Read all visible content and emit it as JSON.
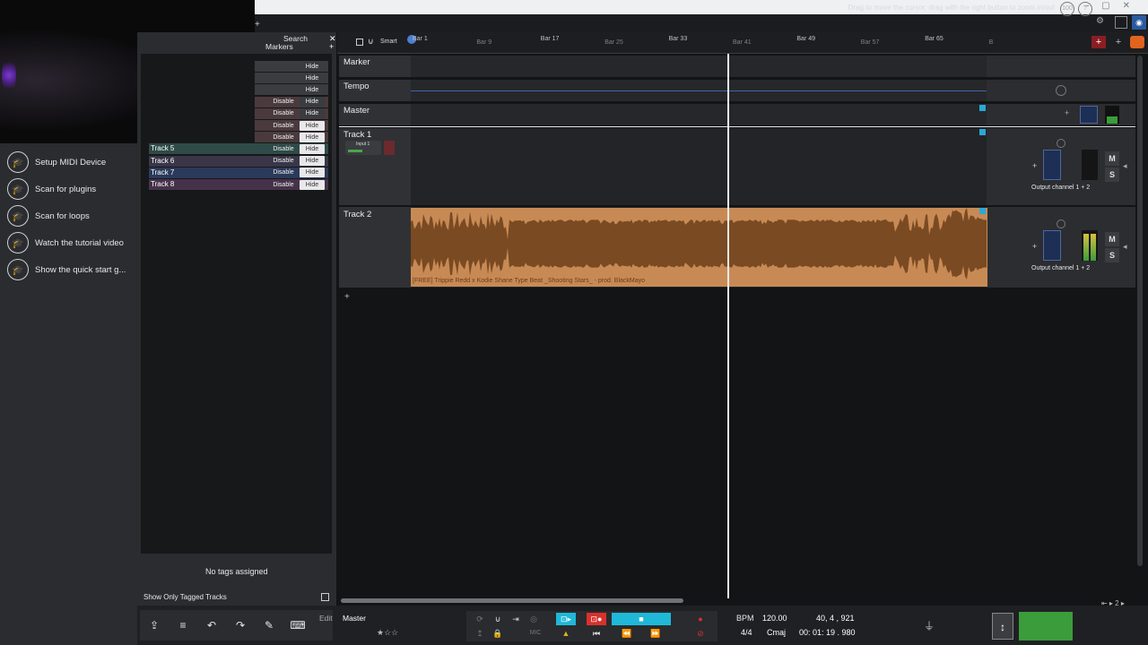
{
  "header": {
    "hint": "Drag to move the cursor, drag with the right button to zoom in/out",
    "zoom": "100"
  },
  "left_sidebar": {
    "items": [
      {
        "label": "Setup MIDI Device",
        "icon": "graduation-cap-icon"
      },
      {
        "label": "Scan for plugins",
        "icon": "graduation-cap-icon"
      },
      {
        "label": "Scan for loops",
        "icon": "graduation-cap-icon"
      },
      {
        "label": "Watch the tutorial video",
        "icon": "graduation-cap-icon"
      },
      {
        "label": "Show the quick start g...",
        "icon": "graduation-cap-icon"
      }
    ]
  },
  "tags_panel": {
    "search_label": "Search",
    "markers_label": "Markers",
    "rows": [
      {
        "name": "",
        "disable": "",
        "hide": "Hide",
        "color": "#3a3c40"
      },
      {
        "name": "",
        "disable": "",
        "hide": "Hide",
        "color": "#3a3c40"
      },
      {
        "name": "",
        "disable": "",
        "hide": "Hide",
        "color": "#3a3c40"
      },
      {
        "name": "",
        "disable": "Disable",
        "hide": "Hide",
        "color": "#4a3a3e"
      },
      {
        "name": "",
        "disable": "Disable",
        "hide": "Hide",
        "color": "#4a3a3e"
      },
      {
        "name": "",
        "disable": "Disable",
        "hide": "Hide",
        "color": "#4a3a3e"
      },
      {
        "name": "",
        "disable": "Disable",
        "hide": "Hide",
        "color": "#4a3a3e"
      },
      {
        "name": "Track 5",
        "disable": "Disable",
        "hide": "Hide",
        "color": "#2f4a48"
      },
      {
        "name": "Track 6",
        "disable": "Disable",
        "hide": "Hide",
        "color": "#3a3648"
      },
      {
        "name": "Track 7",
        "disable": "Disable",
        "hide": "Hide",
        "color": "#2a3a5a"
      },
      {
        "name": "Track 8",
        "disable": "Disable",
        "hide": "Hide",
        "color": "#45324a"
      }
    ],
    "no_tags": "No tags assigned",
    "show_only_tagged": "Show Only Tagged Tracks"
  },
  "ruler": {
    "smart_label": "Smart",
    "bars": [
      {
        "label": "Bar 1",
        "dim": false
      },
      {
        "label": "Bar 9",
        "dim": true
      },
      {
        "label": "Bar 17",
        "dim": false
      },
      {
        "label": "Bar 25",
        "dim": true
      },
      {
        "label": "Bar 33",
        "dim": false
      },
      {
        "label": "Bar 41",
        "dim": true
      },
      {
        "label": "Bar 49",
        "dim": false
      },
      {
        "label": "Bar 57",
        "dim": true
      },
      {
        "label": "Bar 65",
        "dim": false
      },
      {
        "label": "B",
        "dim": true
      }
    ]
  },
  "lanes": {
    "marker": "Marker",
    "tempo": "Tempo",
    "master": "Master",
    "track1": {
      "name": "Track 1",
      "input": "Input 1",
      "output": "Output channel 1 + 2",
      "mute": "M",
      "solo": "S"
    },
    "track2": {
      "name": "Track 2",
      "clip": "[FREE] Trippie Redd x Kodie Shane Type Beat _Shooting Stars_ - prod. BlackMayo",
      "output": "Output channel 1 + 2",
      "mute": "M",
      "solo": "S"
    }
  },
  "transport": {
    "edit_label": "Edit",
    "edit_value": "Master",
    "mic_label": "MIC",
    "bpm_label": "BPM",
    "bpm": "120.00",
    "position": "40, 4 , 921",
    "signature": "4/4",
    "key": "Cmaj",
    "time": "00: 01: 19 . 980"
  },
  "colors": {
    "clip": "#c88a55",
    "clip_dark": "#7a4a22",
    "accent_cyan": "#1fb8d8",
    "record_red": "#d9312c",
    "meter_green": "#3b9c3b"
  }
}
